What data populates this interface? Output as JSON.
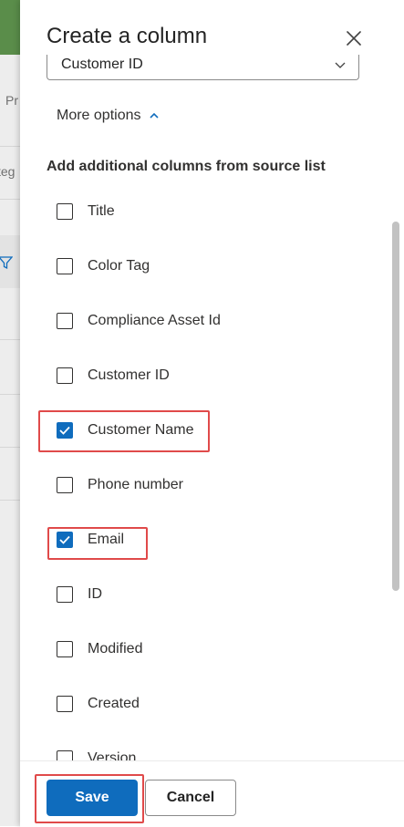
{
  "background": {
    "fragments": [
      "Pr",
      "teg"
    ]
  },
  "panel": {
    "title": "Create a column",
    "lookup_column_value": "Customer ID",
    "more_options_label": "More options",
    "additional_columns_heading": "Add additional columns from source list",
    "columns": [
      {
        "label": "Title",
        "checked": false
      },
      {
        "label": "Color Tag",
        "checked": false
      },
      {
        "label": "Compliance Asset Id",
        "checked": false
      },
      {
        "label": "Customer ID",
        "checked": false
      },
      {
        "label": "Customer Name",
        "checked": true
      },
      {
        "label": "Phone number",
        "checked": false
      },
      {
        "label": "Email",
        "checked": true
      },
      {
        "label": "ID",
        "checked": false
      },
      {
        "label": "Modified",
        "checked": false
      },
      {
        "label": "Created",
        "checked": false
      },
      {
        "label": "Version",
        "checked": false
      }
    ],
    "save_label": "Save",
    "cancel_label": "Cancel"
  },
  "colors": {
    "accent": "#0f6cbd",
    "highlight": "#e04a4a"
  }
}
